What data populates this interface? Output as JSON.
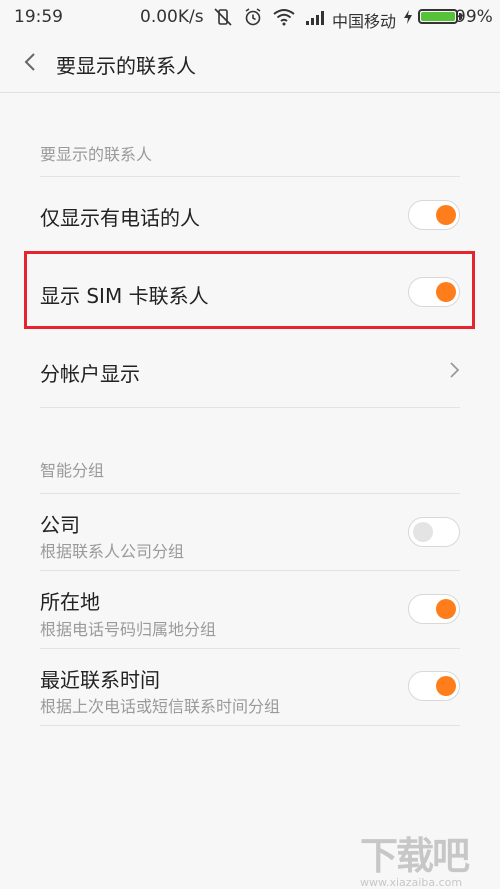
{
  "status_bar": {
    "time": "19:59",
    "speed": "0.00K/s",
    "carrier": "中国移动",
    "battery_level": "99%",
    "battery_percent": 99
  },
  "app_bar": {
    "title": "要显示的联系人"
  },
  "section_contacts": {
    "header": "要显示的联系人",
    "items": [
      {
        "label": "仅显示有电话的人",
        "toggle": "on"
      },
      {
        "label": "显示 SIM 卡联系人",
        "toggle": "on"
      },
      {
        "label": "分帐户显示",
        "chevron": true
      }
    ]
  },
  "section_groups": {
    "header": "智能分组",
    "items": [
      {
        "label": "公司",
        "sub": "根据联系人公司分组",
        "toggle": "off"
      },
      {
        "label": "所在地",
        "sub": "根据电话号码归属地分组",
        "toggle": "on"
      },
      {
        "label": "最近联系时间",
        "sub": "根据上次电话或短信联系时间分组",
        "toggle": "on"
      }
    ]
  },
  "watermark": {
    "text": "下载吧",
    "url": "www.xiazaiba.com"
  },
  "colors": {
    "accent": "#ff7e1b",
    "highlight": "#e5242e",
    "battery": "#55c23a"
  }
}
